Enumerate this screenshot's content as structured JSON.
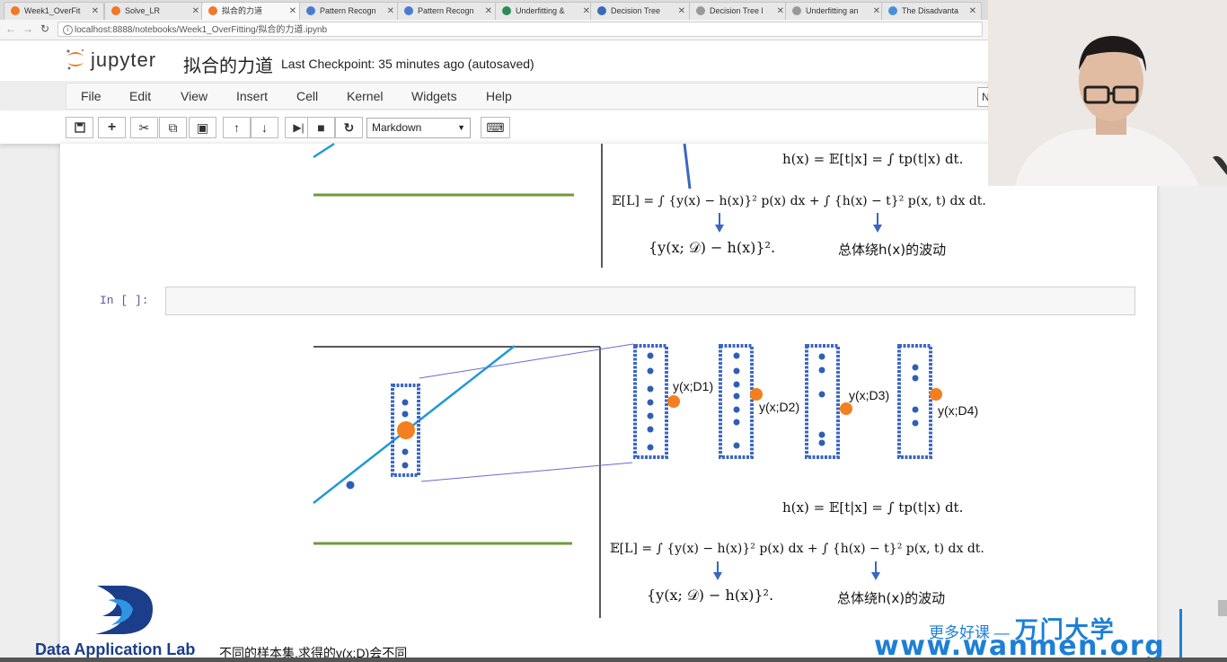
{
  "browser": {
    "tabs": [
      {
        "label": "Week1_OverFit",
        "icon_color": "#f37726"
      },
      {
        "label": "Solve_LR",
        "icon_color": "#f37726"
      },
      {
        "label": "拟合的力道",
        "icon_color": "#f37726"
      },
      {
        "label": "Pattern Recogn",
        "icon_color": "#4a7bd0"
      },
      {
        "label": "Pattern Recogn",
        "icon_color": "#4a7bd0"
      },
      {
        "label": "Underfitting &",
        "icon_color": "#2e8b57"
      },
      {
        "label": "Decision Tree",
        "icon_color": "#3a6bb5"
      },
      {
        "label": "Decision Tree l",
        "icon_color": "#999999"
      },
      {
        "label": "Underfitting an",
        "icon_color": "#999999"
      },
      {
        "label": "The Disadvanta",
        "icon_color": "#4a90d9"
      }
    ],
    "url": "localhost:8888/notebooks/Week1_OverFitting/拟合的力道.ipynb"
  },
  "jupyter": {
    "logo_text": "jupyter",
    "notebook_title": "拟合的力道",
    "checkpoint": "Last Checkpoint: 35 minutes ago (autosaved)",
    "menu": [
      "File",
      "Edit",
      "View",
      "Insert",
      "Cell",
      "Kernel",
      "Widgets",
      "Help"
    ],
    "kernel_indicator": "N",
    "toolbar": {
      "save_icon": "floppy-icon",
      "cell_type": "Markdown"
    },
    "cell_prompt": "In  [  ]:"
  },
  "figure_top": {
    "eq_h": "h(x) = 𝔼[t|x] = ∫ tp(t|x) dt.",
    "eq_loss": "𝔼[L] = ∫ {y(x) − h(x)}² p(x) dx + ∫ {h(x) − t}² p(x, t) dx dt.",
    "eq_var": "{y(x; 𝒟) − h(x)}².",
    "noise_label": "总体绕h(x)的波动"
  },
  "figure_bottom": {
    "labels": [
      "y(x;D1)",
      "y(x;D2)",
      "y(x;D3)",
      "y(x;D4)"
    ],
    "eq_h": "h(x) = 𝔼[t|x] = ∫ tp(t|x) dt.",
    "eq_loss": "𝔼[L] = ∫ {y(x) − h(x)}² p(x) dx + ∫ {h(x) − t}² p(x, t) dx dt.",
    "eq_var": "{y(x; 𝒟) − h(x)}².",
    "noise_label": "总体绕h(x)的波动"
  },
  "markdown_line": "不同的样本集,求得的y(x;D)会不同",
  "watermarks": {
    "dal_text": "Data Application Lab",
    "wanmen_tag": "更多好课 —",
    "wanmen_brand": "万门大学",
    "wanmen_url": "www.wanmen.org"
  },
  "colors": {
    "accent_blue": "#1f9ad6",
    "box_blue": "#3b66c4",
    "orange": "#f47f20",
    "green": "#6f9a3a",
    "jupyter_orange": "#f37726"
  }
}
